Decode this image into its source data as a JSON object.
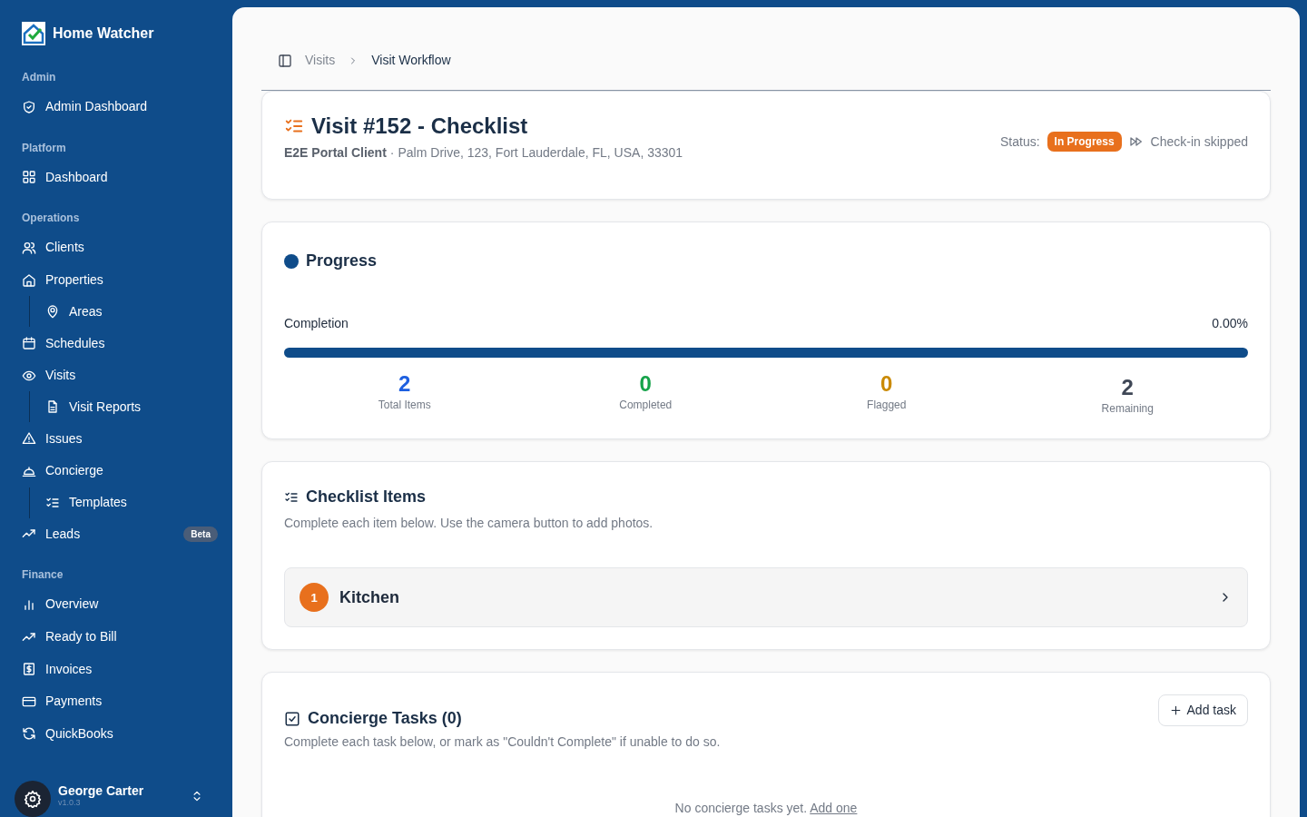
{
  "brand": {
    "name": "Home Watcher"
  },
  "sidebar": {
    "sections": [
      {
        "title": "Admin",
        "items": [
          {
            "label": "Admin Dashboard"
          }
        ]
      },
      {
        "title": "Platform",
        "items": [
          {
            "label": "Dashboard"
          }
        ]
      },
      {
        "title": "Operations",
        "items": [
          {
            "label": "Clients"
          },
          {
            "label": "Properties",
            "children": [
              {
                "label": "Areas"
              }
            ]
          },
          {
            "label": "Schedules"
          },
          {
            "label": "Visits",
            "children": [
              {
                "label": "Visit Reports"
              }
            ]
          },
          {
            "label": "Issues"
          },
          {
            "label": "Concierge",
            "children": [
              {
                "label": "Templates"
              }
            ]
          },
          {
            "label": "Leads",
            "badge": "Beta"
          }
        ]
      },
      {
        "title": "Finance",
        "items": [
          {
            "label": "Overview"
          },
          {
            "label": "Ready to Bill"
          },
          {
            "label": "Invoices"
          },
          {
            "label": "Payments"
          },
          {
            "label": "QuickBooks"
          }
        ]
      }
    ],
    "user": {
      "name": "George Carter",
      "version": "v1.0.3"
    }
  },
  "breadcrumb": [
    {
      "label": "Visits"
    },
    {
      "label": "Visit Workflow"
    }
  ],
  "header": {
    "title": "Visit #152 - Checklist",
    "client": "E2E Portal Client",
    "separator": "·",
    "address": "Palm Drive, 123, Fort Lauderdale, FL, USA, 33301",
    "status_label": "Status:",
    "status": "In Progress",
    "checkin": "Check-in skipped"
  },
  "progress": {
    "title": "Progress",
    "label": "Completion",
    "reading": "0.00%",
    "level": 1,
    "stats": [
      {
        "value": "2",
        "label": "Total Items",
        "color": "#1d5fe0"
      },
      {
        "value": "0",
        "label": "Completed",
        "color": "#16a34a"
      },
      {
        "value": "0",
        "label": "Flagged",
        "color": "#ca8a04"
      },
      {
        "value": "2",
        "label": "Remaining",
        "color": "#3f4756"
      }
    ]
  },
  "checklist": {
    "title": "Checklist Items",
    "description": "Complete each item below. Use the camera button to add photos.",
    "areas": [
      {
        "number": "1",
        "name": "Kitchen",
        "expanded": false
      }
    ]
  },
  "concierge": {
    "title": "Concierge Tasks (0)",
    "description": "Complete each task below, or mark as \"Couldn't Complete\" if unable to do so.",
    "add_button": "Add task",
    "empty": "No concierge tasks yet.",
    "empty_link": "Add one"
  }
}
